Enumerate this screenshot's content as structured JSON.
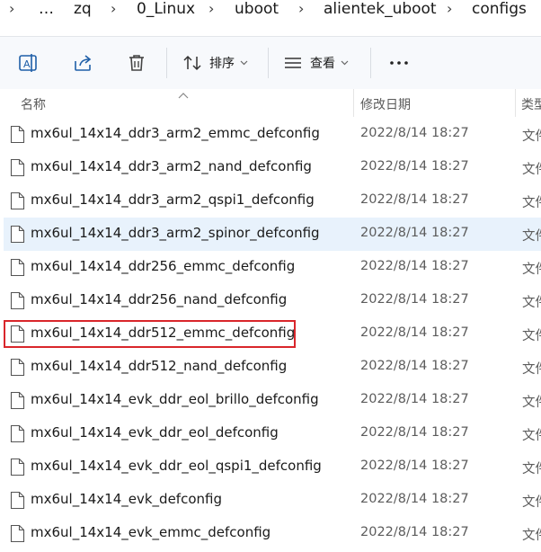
{
  "breadcrumb": {
    "items": [
      {
        "label": "…"
      },
      {
        "label": "zq"
      },
      {
        "label": "0_Linux"
      },
      {
        "label": "uboot"
      },
      {
        "label": "alientek_uboot"
      },
      {
        "label": "configs"
      }
    ]
  },
  "toolbar": {
    "rename_icon": "rename-icon",
    "share_icon": "share-icon",
    "delete_icon": "trash-icon",
    "sort_label": "排序",
    "view_label": "查看",
    "more_label": "···"
  },
  "columns": {
    "name": "名称",
    "date": "修改日期",
    "type": "类型"
  },
  "files": [
    {
      "name": "mx6ul_14x14_ddr3_arm2_emmc_defconfig",
      "date": "2022/8/14 18:27",
      "type": "文件"
    },
    {
      "name": "mx6ul_14x14_ddr3_arm2_nand_defconfig",
      "date": "2022/8/14 18:27",
      "type": "文件"
    },
    {
      "name": "mx6ul_14x14_ddr3_arm2_qspi1_defconfig",
      "date": "2022/8/14 18:27",
      "type": "文件"
    },
    {
      "name": "mx6ul_14x14_ddr3_arm2_spinor_defconfig",
      "date": "2022/8/14 18:27",
      "type": "文件",
      "hovered": true
    },
    {
      "name": "mx6ul_14x14_ddr256_emmc_defconfig",
      "date": "2022/8/14 18:27",
      "type": "文件"
    },
    {
      "name": "mx6ul_14x14_ddr256_nand_defconfig",
      "date": "2022/8/14 18:27",
      "type": "文件"
    },
    {
      "name": "mx6ul_14x14_ddr512_emmc_defconfig",
      "date": "2022/8/14 18:27",
      "type": "文件",
      "annotated": true
    },
    {
      "name": "mx6ul_14x14_ddr512_nand_defconfig",
      "date": "2022/8/14 18:27",
      "type": "文件"
    },
    {
      "name": "mx6ul_14x14_evk_ddr_eol_brillo_defconfig",
      "date": "2022/8/14 18:27",
      "type": "文件"
    },
    {
      "name": "mx6ul_14x14_evk_ddr_eol_defconfig",
      "date": "2022/8/14 18:27",
      "type": "文件"
    },
    {
      "name": "mx6ul_14x14_evk_ddr_eol_qspi1_defconfig",
      "date": "2022/8/14 18:27",
      "type": "文件"
    },
    {
      "name": "mx6ul_14x14_evk_defconfig",
      "date": "2022/8/14 18:27",
      "type": "文件"
    },
    {
      "name": "mx6ul_14x14_evk_emmc_defconfig",
      "date": "2022/8/14 18:27",
      "type": "文件"
    }
  ],
  "colors": {
    "hover_row": "#e8f2fc",
    "annotation_box": "#d9262b",
    "toolbar_bg": "#f7f9fc"
  }
}
